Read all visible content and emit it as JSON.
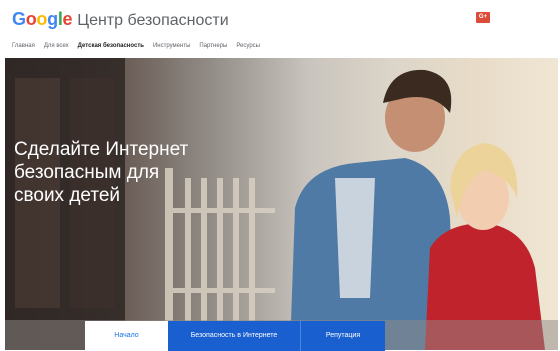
{
  "header": {
    "logo_letters": [
      {
        "ch": "G",
        "color": "#4285F4"
      },
      {
        "ch": "o",
        "color": "#EA4335"
      },
      {
        "ch": "o",
        "color": "#FBBC05"
      },
      {
        "ch": "g",
        "color": "#4285F4"
      },
      {
        "ch": "l",
        "color": "#34A853"
      },
      {
        "ch": "e",
        "color": "#EA4335"
      }
    ],
    "site_title": "Центр безопасности",
    "gplus_label": "G+"
  },
  "nav": {
    "items": [
      {
        "label": "Главная",
        "active": false
      },
      {
        "label": "Для всех",
        "active": false
      },
      {
        "label": "Детская безопасность",
        "active": true
      },
      {
        "label": "Инструменты",
        "active": false
      },
      {
        "label": "Партнеры",
        "active": false
      },
      {
        "label": "Ресурсы",
        "active": false
      }
    ]
  },
  "hero": {
    "headline": "Сделайте Интернет безопасным для своих детей"
  },
  "tabs": {
    "start": "Начало",
    "internet": "Безопасность в Интернете",
    "reputation": "Репутация"
  },
  "colors": {
    "accent": "#1a5fcf",
    "link": "#1a73e8"
  }
}
